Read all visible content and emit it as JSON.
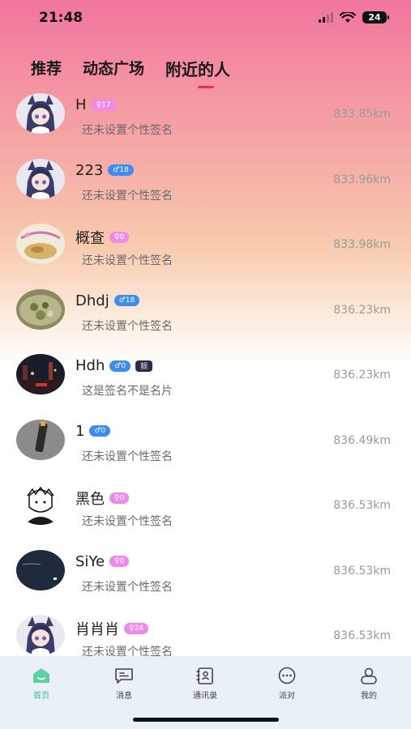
{
  "status": {
    "time": "21:48",
    "battery": "24"
  },
  "tabs": [
    {
      "label": "推荐"
    },
    {
      "label": "动态广场"
    },
    {
      "label": "附近的人"
    }
  ],
  "users": [
    {
      "name": "H",
      "badge": "♀17",
      "gender": "female",
      "signature": "还未设置个性签名",
      "distance": "833.85km",
      "avatar": "anime"
    },
    {
      "name": "223",
      "badge": "♂18",
      "gender": "male",
      "signature": "还未设置个性签名",
      "distance": "833.96km",
      "avatar": "anime"
    },
    {
      "name": "概查",
      "badge": "♀0",
      "gender": "female",
      "signature": "还未设置个性签名",
      "distance": "833.98km",
      "avatar": "food"
    },
    {
      "name": "Dhdj",
      "badge": "♂18",
      "gender": "male",
      "signature": "还未设置个性签名",
      "distance": "836.23km",
      "avatar": "dish"
    },
    {
      "name": "Hdh",
      "badge": "♂0",
      "gender": "male",
      "extra_badge": "靓",
      "signature": "这是签名不是名片",
      "distance": "836.23km",
      "avatar": "night"
    },
    {
      "name": "1",
      "badge": "♂0",
      "gender": "male",
      "signature": "还未设置个性签名",
      "distance": "836.49km",
      "avatar": "dark"
    },
    {
      "name": "黑色",
      "badge": "♀0",
      "gender": "female",
      "signature": "还未设置个性签名",
      "distance": "836.53km",
      "avatar": "sketch"
    },
    {
      "name": "SiYe",
      "badge": "♀0",
      "gender": "female",
      "signature": "还未设置个性签名",
      "distance": "836.53km",
      "avatar": "navy"
    },
    {
      "name": "肖肖肖",
      "badge": "♀24",
      "gender": "female",
      "signature": "还未设置个性签名",
      "distance": "836.53km",
      "avatar": "anime"
    }
  ],
  "tabbar": [
    {
      "label": "首页",
      "icon": "home-icon"
    },
    {
      "label": "消息",
      "icon": "message-icon"
    },
    {
      "label": "通讯录",
      "icon": "contacts-icon"
    },
    {
      "label": "派对",
      "icon": "party-icon"
    },
    {
      "label": "我的",
      "icon": "profile-icon"
    }
  ]
}
